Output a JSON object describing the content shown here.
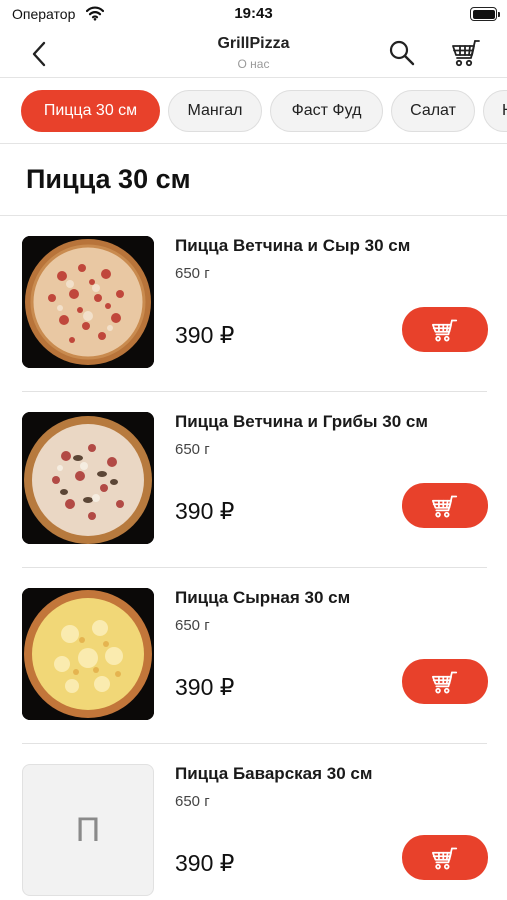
{
  "status": {
    "carrier": "Оператор",
    "time": "19:43"
  },
  "nav": {
    "title": "GrillPizza",
    "subtitle": "О нас"
  },
  "categories": [
    {
      "label": "Пицца 30 см",
      "active": true
    },
    {
      "label": "Мангал",
      "active": false
    },
    {
      "label": "Фаст Фуд",
      "active": false
    },
    {
      "label": "Салат",
      "active": false
    },
    {
      "label": "Н",
      "active": false
    }
  ],
  "section_title": "Пицца 30 см",
  "products": [
    {
      "name": "Пицца Ветчина и Сыр 30 см",
      "weight": "650 г",
      "price": "390 ₽",
      "image": "pizza-ham-cheese"
    },
    {
      "name": "Пицца Ветчина и Грибы 30 см",
      "weight": "650 г",
      "price": "390 ₽",
      "image": "pizza-ham-mushroom"
    },
    {
      "name": "Пицца Сырная 30 см",
      "weight": "650 г",
      "price": "390 ₽",
      "image": "pizza-cheese"
    },
    {
      "name": "Пицца Баварская 30 см",
      "weight": "650 г",
      "price": "390 ₽",
      "image": "placeholder",
      "placeholder_letter": "П"
    }
  ],
  "icons": {
    "back": "chevron-left-icon",
    "search": "search-icon",
    "cart": "cart-icon",
    "wifi": "wifi-icon",
    "battery": "battery-icon"
  },
  "colors": {
    "accent": "#e8412b",
    "chip_bg": "#f3f3f3",
    "divider": "#e4e4e4",
    "muted_text": "#9a9a9a"
  }
}
